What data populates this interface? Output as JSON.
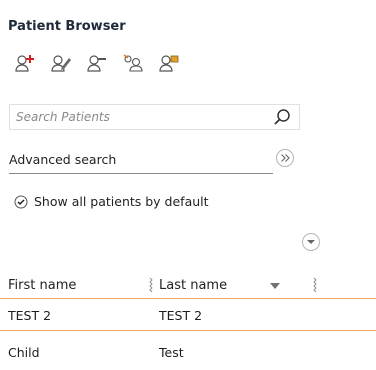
{
  "title": "Patient Browser",
  "toolbar": {
    "icons": [
      "add-patient-icon",
      "edit-patient-icon",
      "remove-patient-icon",
      "merge-patients-icon",
      "patient-history-icon"
    ]
  },
  "search": {
    "placeholder": "Search Patients",
    "value": ""
  },
  "advanced_search_label": "Advanced search",
  "show_all_label": "Show all patients by default",
  "show_all_checked": true,
  "table": {
    "columns": [
      "First name",
      "Last name"
    ],
    "rows": [
      {
        "first": "TEST 2",
        "last": "TEST 2"
      },
      {
        "first": "Child",
        "last": "Test"
      }
    ]
  },
  "colors": {
    "accent_line": "#f0a868",
    "title": "#1f2a3a"
  }
}
